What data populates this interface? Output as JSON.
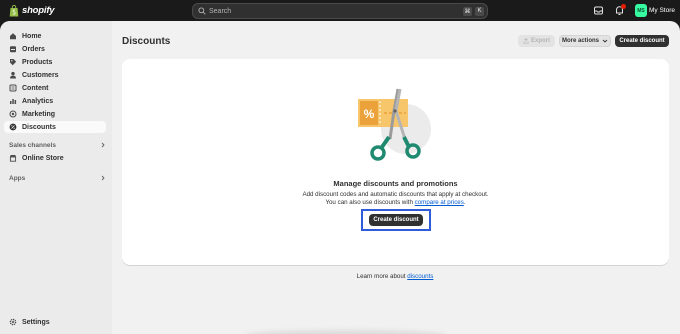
{
  "brand": {
    "name": "shopify"
  },
  "search": {
    "placeholder": "Search",
    "shortcut_1": "⌘",
    "shortcut_2": "K"
  },
  "store": {
    "initials": "MS",
    "name": "My Store"
  },
  "sidebar": {
    "items": [
      {
        "label": "Home",
        "icon": "home-icon"
      },
      {
        "label": "Orders",
        "icon": "orders-icon"
      },
      {
        "label": "Products",
        "icon": "tag-icon"
      },
      {
        "label": "Customers",
        "icon": "person-icon"
      },
      {
        "label": "Content",
        "icon": "content-icon"
      },
      {
        "label": "Analytics",
        "icon": "chart-icon"
      },
      {
        "label": "Marketing",
        "icon": "target-icon"
      },
      {
        "label": "Discounts",
        "icon": "discount-icon",
        "active": true
      }
    ],
    "sales_channels": {
      "label": "Sales channels",
      "items": [
        {
          "label": "Online Store",
          "icon": "store-icon"
        }
      ]
    },
    "apps": {
      "label": "Apps"
    },
    "settings": {
      "label": "Settings",
      "icon": "gear-icon"
    }
  },
  "page": {
    "title": "Discounts",
    "export_label": "Export",
    "more_actions_label": "More actions",
    "create_top_label": "Create discount"
  },
  "empty_state": {
    "heading": "Manage discounts and promotions",
    "desc_line1": "Add discount codes and automatic discounts that apply at checkout.",
    "desc_line2_prefix": "You can also use discounts with ",
    "desc_line2_link": "compare at prices",
    "desc_line2_suffix": ".",
    "create_label": "Create discount",
    "illustration": "scissors-coupon-illustration"
  },
  "footer": {
    "learn_prefix": "Learn more about ",
    "learn_link": "discounts"
  },
  "colors": {
    "accent_highlight": "#2f5bd8",
    "link": "#005bd3",
    "primary_button": "#303030"
  }
}
